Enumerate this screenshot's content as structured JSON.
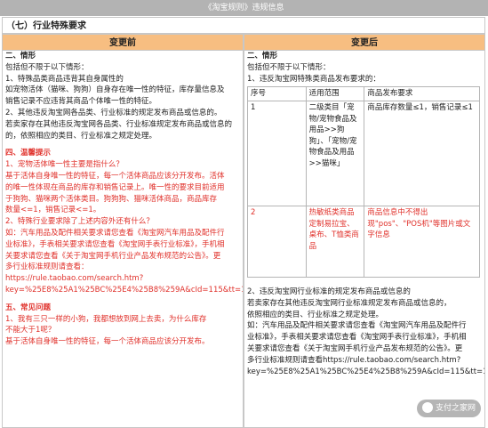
{
  "header": {
    "title": "《淘宝规则》违规信息"
  },
  "section_title": "（七）行业特殊要求",
  "columns": {
    "before": "变更前",
    "after": "变更后"
  },
  "left": {
    "lines": [
      {
        "t": "二、情形",
        "c": "bold"
      },
      {
        "t": "包括但不限于以下情形："
      },
      {
        "t": "1、特殊品类商品违背其自身属性的"
      },
      {
        "t": "如宠物活体（猫咪、狗狗）自身存在唯一性的特征，库存量信息及"
      },
      {
        "t": "销售记录不应违背其商品个体唯一性的特征。"
      },
      {
        "t": "2、其他违反淘宝网各品类、行业标准的规定发布商品或信息的。"
      },
      {
        "t": "若卖家存在其他违反淘宝网各品类、行业标准规定发布商品或信息的"
      },
      {
        "t": "的，依照相应的类目、行业标准之规定处理。"
      },
      {
        "t": "",
        "c": "gap"
      },
      {
        "t": "四、温馨提示",
        "c": "bold red"
      },
      {
        "t": "1、宠物活体唯一性主要是指什么？",
        "c": "red"
      },
      {
        "t": "基于活体自身唯一性的特征，每一个活体商品应该分开发布。活体",
        "c": "red"
      },
      {
        "t": "的唯一性体现在商品的库存和销售记录上。唯一性的要求目前适用",
        "c": "red"
      },
      {
        "t": "于狗狗、猫咪两个活体类目。狗狗狗、猫咪活体商品，商品库存",
        "c": "red"
      },
      {
        "t": "数量<=1，销售记录<=1。",
        "c": "red"
      },
      {
        "t": "2、特殊行业要求除了上述内容外还有什么？",
        "c": "red"
      },
      {
        "t": "如：汽车用品及配件相关要求请您查看《淘宝网汽车用品及配件行",
        "c": "red"
      },
      {
        "t": "业标准》，手表相关要求请您查看《淘宝网手表行业标准》，手机相",
        "c": "red"
      },
      {
        "t": "关要求请您查看《关于淘宝网手机行业产品发布规范的公告》。更",
        "c": "red"
      },
      {
        "t": "多行业标准规则请查看：",
        "c": "red"
      },
      {
        "t": "https://rule.taobao.com/search.htm?",
        "c": "red"
      },
      {
        "t": "key=%25E8%25A1%25BC%25E4%25B8%259A&cId=115&tt=1&pageIndex=0",
        "c": "red"
      },
      {
        "t": "",
        "c": "gap"
      },
      {
        "t": "五、常见问题",
        "c": "bold red"
      },
      {
        "t": "1、我有三只一样的小狗，我都想放到网上去卖，为什么库存",
        "c": "red"
      },
      {
        "t": "不能大于1呢？",
        "c": "red"
      },
      {
        "t": "基于活体自身唯一性的特征，每一个活体商品应该分开发布。",
        "c": "red"
      }
    ]
  },
  "right": {
    "intro": [
      {
        "t": "二、情形",
        "c": "bold"
      },
      {
        "t": "包括但不限于以下情形："
      },
      {
        "t": "1、违反淘宝网特殊类商品发布要求的："
      }
    ],
    "table": {
      "headers": [
        "序号",
        "适用范围",
        "商品发布要求"
      ],
      "rows": [
        {
          "no": "1",
          "scope": "二级类目「宠物/宠物食品及用品>>狗狗」、「宠物/宠物食品及用品>>猫咪」",
          "req": "商品库存数量≤1，销售记录≤1",
          "c": ""
        },
        {
          "no": "2",
          "scope": "热敏纸类商品 定制易拉宝、桌布、T恤类商品",
          "req": "商品信息中不得出现\"pos\"、\"POS机\"等图片或文字信息",
          "c": "red"
        }
      ]
    },
    "lines": [
      {
        "t": "2、违反淘宝网行业标准的规定发布商品或信息的"
      },
      {
        "t": "若卖家存在其他违反淘宝网行业标准规定发布商品或信息的，"
      },
      {
        "t": "依照相应的类目、行业标准之规定处理。"
      },
      {
        "t": "如：汽车用品及配件相关要求请您查看《淘宝网汽车用品及配件行"
      },
      {
        "t": "业标准》，手表相关要求请您查看《淘宝网手表行业标准》，手机相"
      },
      {
        "t": "关要求请您查看《关于淘宝网手机行业产品发布规范的公告》。更"
      },
      {
        "t": "多行业标准规则请查看https://rule.taobao.com/search.htm?"
      },
      {
        "t": "key=%25E8%25A1%25BC%25E4%25B8%259A&cId=115&tt=1"
      }
    ]
  },
  "watermark": {
    "text": "支付之家网"
  }
}
